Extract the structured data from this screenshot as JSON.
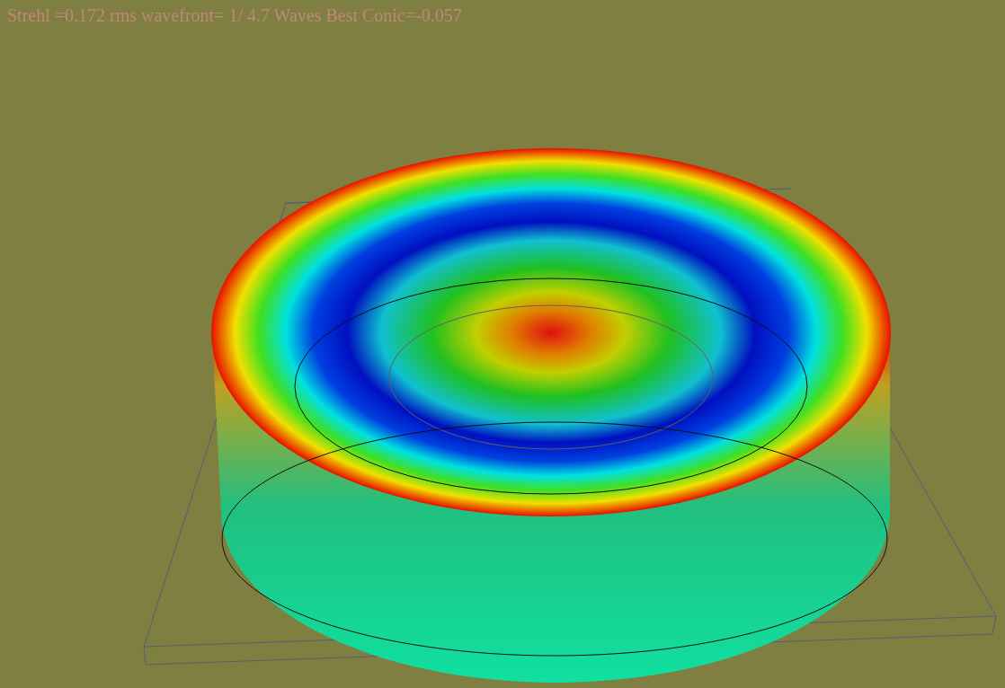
{
  "header": {
    "text": "Strehl =0.172 rms wavefront= 1/ 4.7 Waves Best Conic=-0.057"
  }
}
